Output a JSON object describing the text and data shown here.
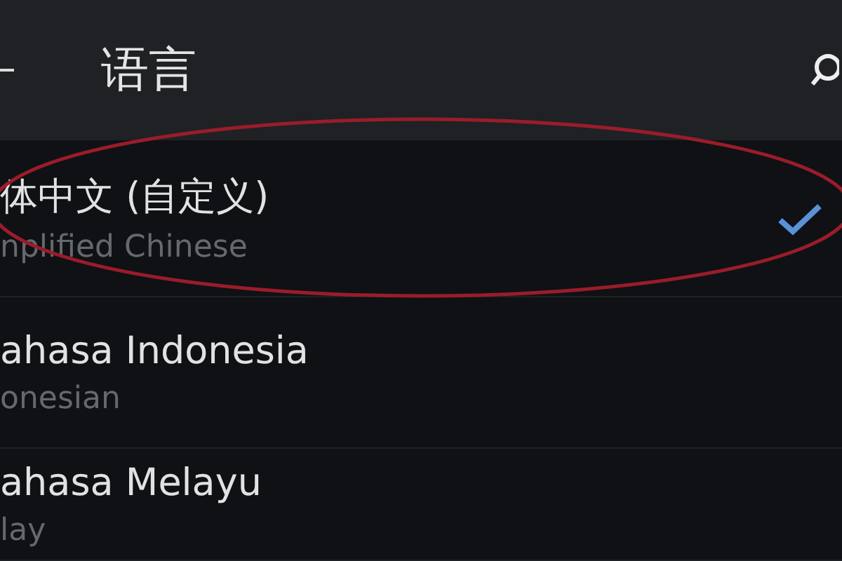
{
  "header": {
    "title": "语言"
  },
  "languages": [
    {
      "name": "体中文 (自定义)",
      "subtitle": "nplified Chinese",
      "selected": true,
      "circled": true
    },
    {
      "name": "ahasa Indonesia",
      "subtitle": "onesian",
      "selected": false,
      "circled": false
    },
    {
      "name": "ahasa Melayu",
      "subtitle": "lay",
      "selected": false,
      "circled": false
    }
  ]
}
